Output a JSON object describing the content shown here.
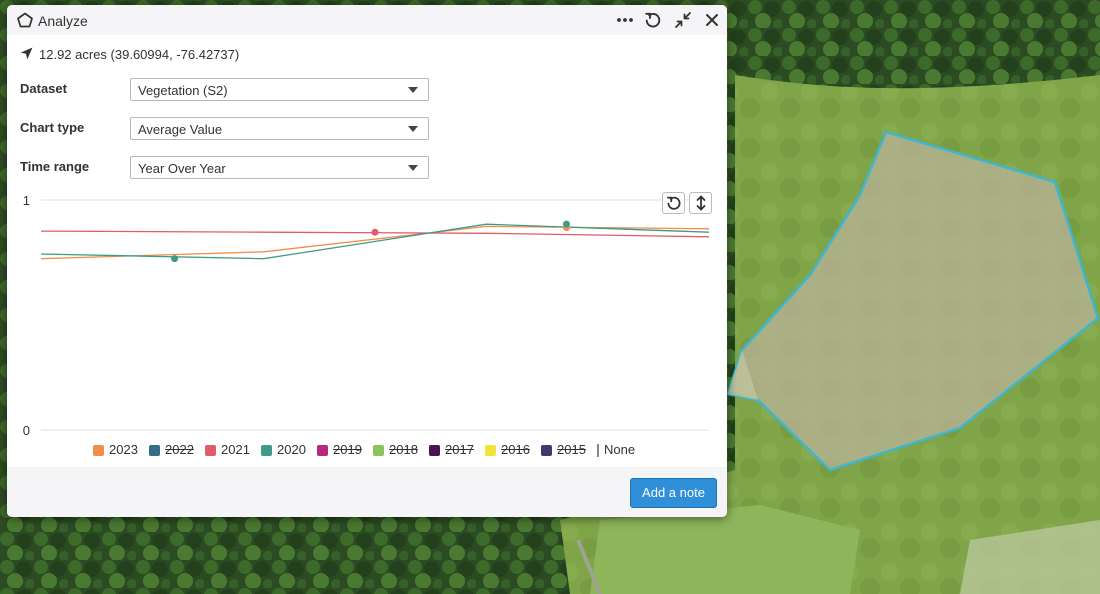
{
  "panel": {
    "title": "Analyze",
    "header_icons": [
      "polygon-icon",
      "more-icon",
      "refresh-icon",
      "collapse-icon",
      "close-icon"
    ]
  },
  "location": {
    "icon": "location-arrow-icon",
    "text": "12.92 acres (39.60994, -76.42737)"
  },
  "fields": {
    "dataset": {
      "label": "Dataset",
      "value": "Vegetation (S2)"
    },
    "chart_type": {
      "label": "Chart type",
      "value": "Average Value"
    },
    "time_range": {
      "label": "Time range",
      "value": "Year Over Year"
    }
  },
  "chart_controls": [
    "reset-icon",
    "vertical-scale-icon"
  ],
  "chart_data": {
    "type": "line",
    "ylim": [
      0,
      1
    ],
    "y_ticks": [
      "1",
      "0"
    ],
    "grid": true,
    "legend_position": "bottom",
    "x": [
      0,
      1,
      2,
      3
    ],
    "series": [
      {
        "name": "2023",
        "color": "#f0904a",
        "visible": true,
        "values": [
          0.745,
          0.775,
          0.885,
          0.875
        ]
      },
      {
        "name": "2022",
        "color": "#336e86",
        "visible": false,
        "values": []
      },
      {
        "name": "2021",
        "color": "#e25a6e",
        "visible": true,
        "values": [
          0.865,
          0.86,
          0.855,
          0.84
        ]
      },
      {
        "name": "2020",
        "color": "#3f9a8a",
        "visible": true,
        "values": [
          0.765,
          0.745,
          0.895,
          0.86
        ]
      },
      {
        "name": "2019",
        "color": "#b5287c",
        "visible": false,
        "values": []
      },
      {
        "name": "2018",
        "color": "#8ac45c",
        "visible": false,
        "values": []
      },
      {
        "name": "2017",
        "color": "#4a1352",
        "visible": false,
        "values": []
      },
      {
        "name": "2016",
        "color": "#f2e33a",
        "visible": false,
        "values": []
      },
      {
        "name": "2015",
        "color": "#3d3a72",
        "visible": false,
        "values": []
      }
    ],
    "markers": [
      {
        "series": "2020",
        "x": 0.6,
        "y": 0.745
      },
      {
        "series": "2021",
        "x": 1.5,
        "y": 0.86
      },
      {
        "series": "2023",
        "x": 2.36,
        "y": 0.88
      },
      {
        "series": "2020",
        "x": 2.36,
        "y": 0.895
      }
    ],
    "legend_none_label": "None"
  },
  "footer": {
    "add_note_label": "Add a note"
  },
  "colors": {
    "accent": "#2f8fd8",
    "aoi_outline": "#3fb6cf"
  }
}
